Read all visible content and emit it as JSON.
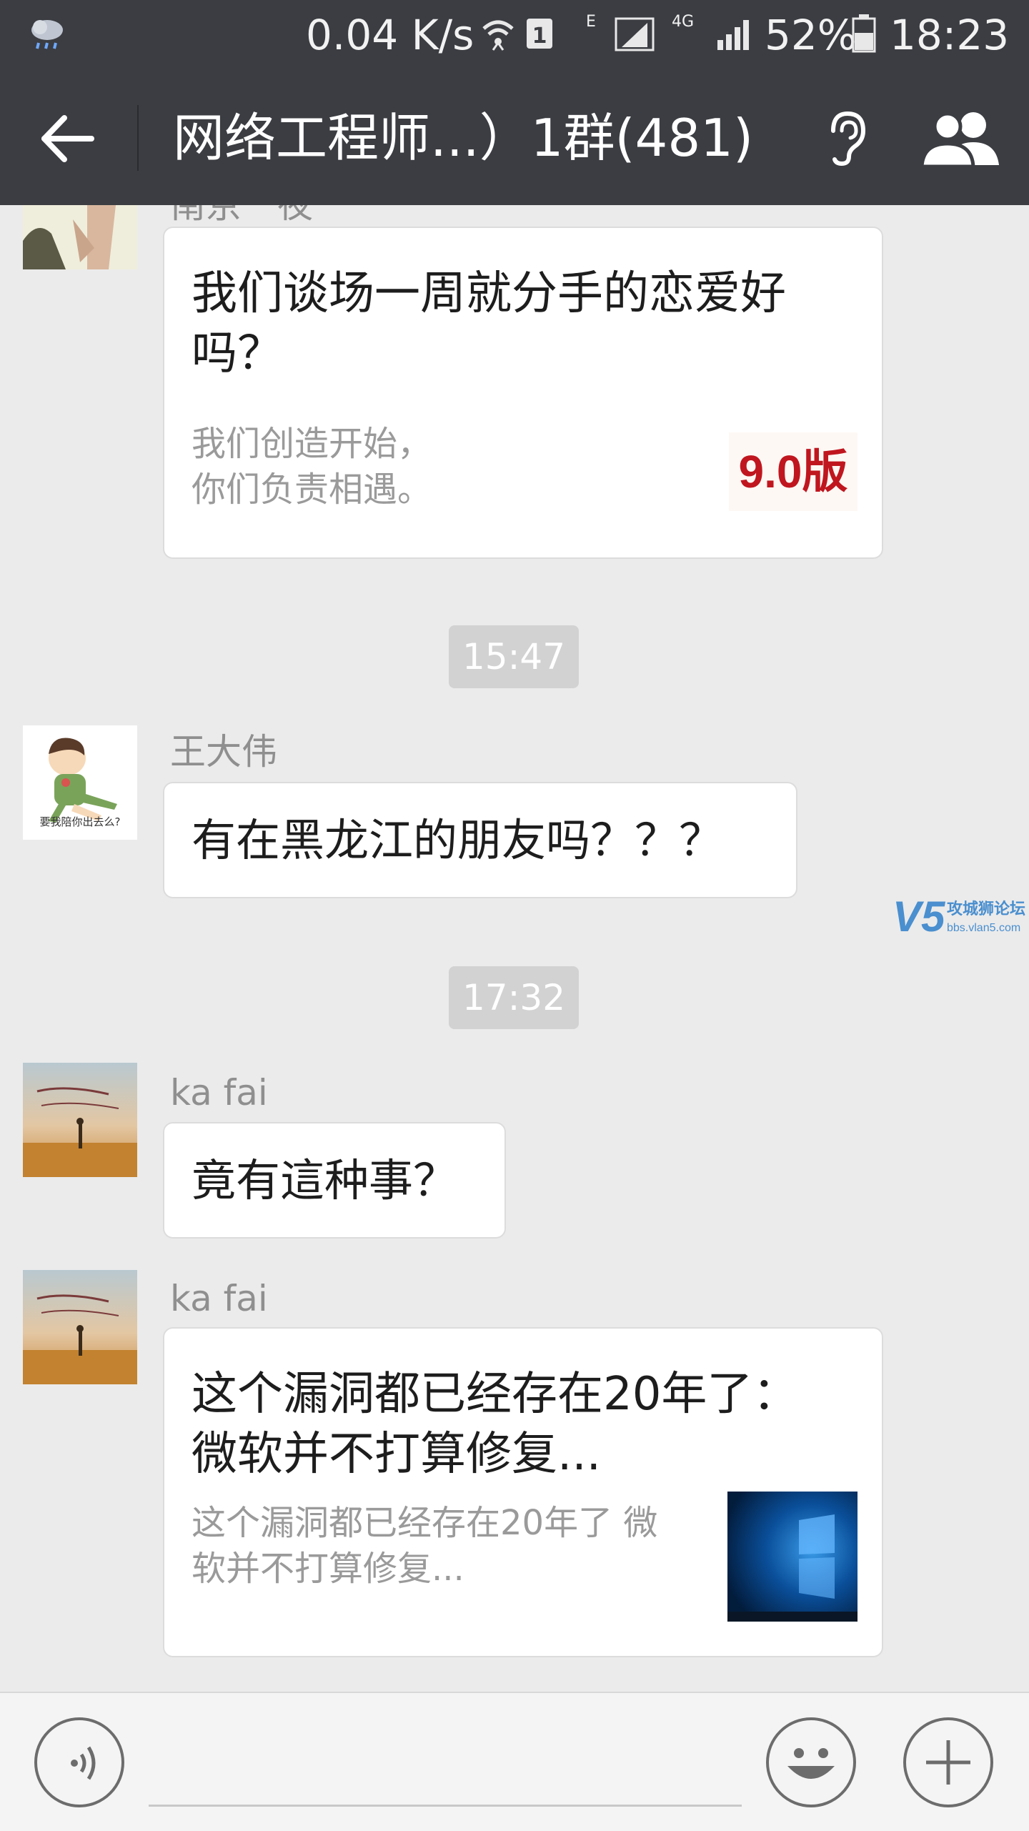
{
  "status_bar": {
    "network_speed": "0.04 K/s",
    "sim_slot": "1",
    "network_e": "E",
    "network_4g": "4G",
    "battery": "52%",
    "time": "18:23"
  },
  "header": {
    "title": "网络工程师...）1群(481)",
    "icons": [
      "back-arrow-icon",
      "ear-icon",
      "group-members-icon"
    ]
  },
  "messages": [
    {
      "type": "link",
      "sender": "南京一夜",
      "title_lines": [
        "我们谈场一周就分手的恋爱好",
        "吗？"
      ],
      "desc_lines": [
        "我们创造开始，",
        "你们负责相遇。"
      ],
      "thumb_text": "9.0版"
    },
    {
      "type": "time",
      "text": "15:47"
    },
    {
      "type": "text",
      "sender": "王大伟",
      "text": "有在黑龙江的朋友吗？？？"
    },
    {
      "type": "time",
      "text": "17:32"
    },
    {
      "type": "text",
      "sender": "ka fai",
      "text": "竟有這种事？"
    },
    {
      "type": "link",
      "sender": "ka fai",
      "title_lines": [
        "这个漏洞都已经存在20年了：",
        "微软并不打算修复..."
      ],
      "desc_lines": [
        "这个漏洞都已经存在20年了 微",
        "软并不打算修复..."
      ]
    }
  ],
  "avatars": {
    "wang_dawei_caption": "要我陪你出去么?"
  },
  "watermark": {
    "logo": "V5",
    "name": "攻城狮论坛",
    "url": "bbs.vlan5.com"
  },
  "colors": {
    "header_bg": "#3b3d42",
    "chat_bg": "#ebebeb",
    "bubble_bg": "#ffffff",
    "timestamp_bg": "#d2d2d2",
    "accent_red": "#c0161f"
  }
}
